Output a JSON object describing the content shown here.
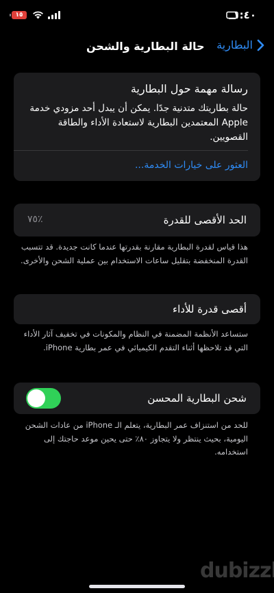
{
  "status_bar": {
    "time": "١:٤٠",
    "battery_level": "١٥",
    "icons": [
      "moon-icon",
      "wifi-icon",
      "signal-icon",
      "battery-icon"
    ]
  },
  "nav": {
    "back_label": "البطارية",
    "title": "حالة البطارية والشحن"
  },
  "info_card": {
    "title": "رسالة مهمة حول البطارية",
    "body": "حالة بطاريتك متدنية جدًا. يمكن أن يبدل أحد مزودي خدمة Apple المعتمدين البطارية لاستعادة الأداء والطاقة القصويين.",
    "link": "العثور على خيارات الخدمة..."
  },
  "capacity": {
    "label": "الحد الأقصى للقدرة",
    "value": "٪٧٥",
    "footnote": "هذا قياس لقدرة البطارية مقارنة بقدرتها عندما كانت جديدة. قد تتسبب القدرة المنخفضة بتقليل ساعات الاستخدام بين عملية الشحن والأخرى."
  },
  "performance": {
    "label": "أقصى قدرة للأداء",
    "footnote": "ستساعد الأنظمة المضمنة في النظام والمكونات في تخفيف آثار الأداء التي قد تلاحظها أثناء التقدم الكيميائي في عمر بطارية iPhone."
  },
  "optimized_charging": {
    "label": "شحن البطارية المحسن",
    "enabled": true,
    "footnote": "للحد من استنزاف عمر البطارية، يتعلم الـ iPhone من عادات الشحن اليومية، بحيث ينتظر ولا يتجاوز ٨٠٪ حتى يحين موعد حاجتك إلى استخدامه."
  },
  "watermark": "dubizzle",
  "colors": {
    "accent": "#2f8cf6",
    "toggle_on": "#30d158",
    "battery_low": "#e0403a",
    "card_bg": "#1c1c1e"
  }
}
